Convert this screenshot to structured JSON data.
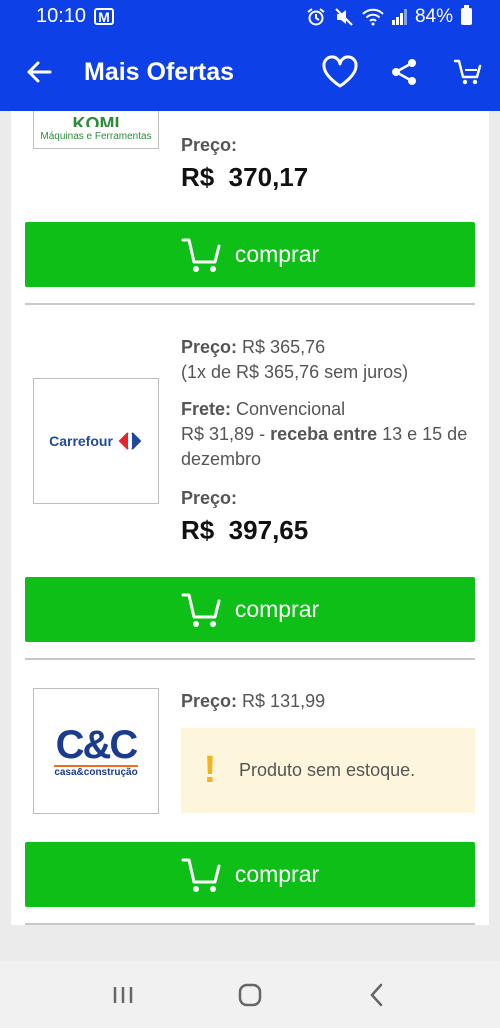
{
  "status_bar": {
    "time": "10:10",
    "notification_badge": "M",
    "battery": "84%"
  },
  "app_bar": {
    "title": "Mais Ofertas"
  },
  "offers": [
    {
      "logo_text": "Máquinas e Ferramentas",
      "price_label": "Preço:",
      "price_total": "R$  370,17",
      "buy_label": "comprar"
    },
    {
      "logo_text": "Carrefour",
      "price_label": "Preço:",
      "price_value": "R$ 365,76",
      "installments": "(1x de R$ 365,76 sem juros)",
      "shipping_label": "Frete:",
      "shipping_type": "Convencional",
      "shipping_price": "R$ 31,89",
      "delivery_separator": " - ",
      "delivery_label": "receba entre",
      "delivery_dates": " 13 e 15 de dezembro",
      "total_label": "Preço:",
      "price_total": "R$  397,65",
      "buy_label": "comprar"
    },
    {
      "logo_text_main": "C&C",
      "logo_text_sub": "casa&construção",
      "price_label": "Preço:",
      "price_value": "R$ 131,99",
      "stock_message": "Produto sem estoque.",
      "stock_icon": "!",
      "buy_label": "comprar"
    }
  ],
  "colors": {
    "primary": "#0d40e6",
    "buy_button": "#0dbf17",
    "warning_bg": "#fdf6dc",
    "warning_icon": "#f2b31c",
    "carrefour_blue": "#1d4b9b",
    "carrefour_red": "#e3262d",
    "cc_blue": "#1b3b8e",
    "cc_orange": "#ef6d1e"
  }
}
